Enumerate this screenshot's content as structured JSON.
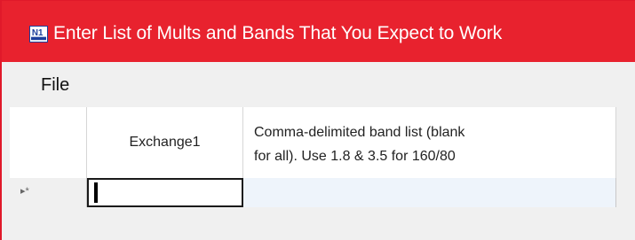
{
  "window": {
    "title": "Enter List of Mults and Bands That You Expect to Work",
    "accent_color": "#e8222e",
    "icon": "n1mm-logo-icon"
  },
  "menubar": {
    "items": [
      {
        "label": "File"
      }
    ]
  },
  "grid": {
    "columns": [
      {
        "header": "Exchange1"
      },
      {
        "header": "Comma-delimited band list (blank\nfor all). Use 1.8 & 3.5 for 160/80"
      }
    ],
    "new_row": {
      "indicator": "▸*",
      "cells": [
        "",
        ""
      ]
    }
  }
}
